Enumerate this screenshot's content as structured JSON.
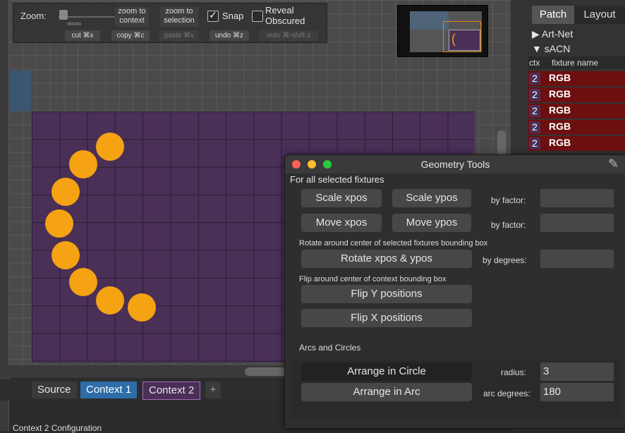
{
  "toolbar": {
    "zoom_label": "Zoom:",
    "zoom_ticks": "ııııııııı",
    "zoom_to_context": "zoom to context",
    "zoom_to_selection": "zoom to selection",
    "snap_label": "Snap",
    "snap_checked": true,
    "reveal_obscured_label": "Reveal Obscured",
    "reveal_checked": false,
    "cut": "cut ⌘x",
    "copy": "copy ⌘c",
    "paste": "paste ⌘v",
    "undo": "undo ⌘z",
    "redo": "redo ⌘-shift-z"
  },
  "tabs": {
    "source": "Source",
    "context1": "Context 1",
    "context2": "Context 2",
    "add": "+"
  },
  "status": "Context 2 Configuration",
  "right_panel": {
    "tab_patch": "Patch",
    "tab_layout": "Layout",
    "artnet": "▶ Art-Net",
    "sacn": "▼ sACN",
    "col_ctx": "ctx",
    "col_name": "fixture name",
    "fixtures": [
      {
        "ctx": "2",
        "name": "RGB"
      },
      {
        "ctx": "2",
        "name": "RGB"
      },
      {
        "ctx": "2",
        "name": "RGB"
      },
      {
        "ctx": "2",
        "name": "RGB"
      },
      {
        "ctx": "2",
        "name": "RGB"
      }
    ]
  },
  "geometry": {
    "title": "Geometry Tools",
    "for_all": "For all selected fixtures",
    "scale_x": "Scale xpos",
    "scale_y": "Scale ypos",
    "by_factor": "by factor:",
    "move_x": "Move xpos",
    "move_y": "Move ypos",
    "rotate_caption": "Rotate around center of selected fixtures bounding box",
    "rotate": "Rotate xpos & ypos",
    "by_degrees": "by degrees:",
    "flip_caption": "Flip around center of context bounding box",
    "flip_y": "Flip Y positions",
    "flip_x": "Flip X positions",
    "arcs_title": "Arcs and Circles",
    "arrange_circle": "Arrange in Circle",
    "radius_label": "radius:",
    "radius_value": "3",
    "arrange_arc": "Arrange in Arc",
    "arc_degrees_label": "arc degrees:",
    "arc_degrees_value": "180"
  },
  "colors": {
    "fixture_dot": "#f5a313",
    "context_purple": "#4a2f57",
    "selected_tab": "#2d6da8",
    "fixture_row": "#6e0f0f"
  }
}
